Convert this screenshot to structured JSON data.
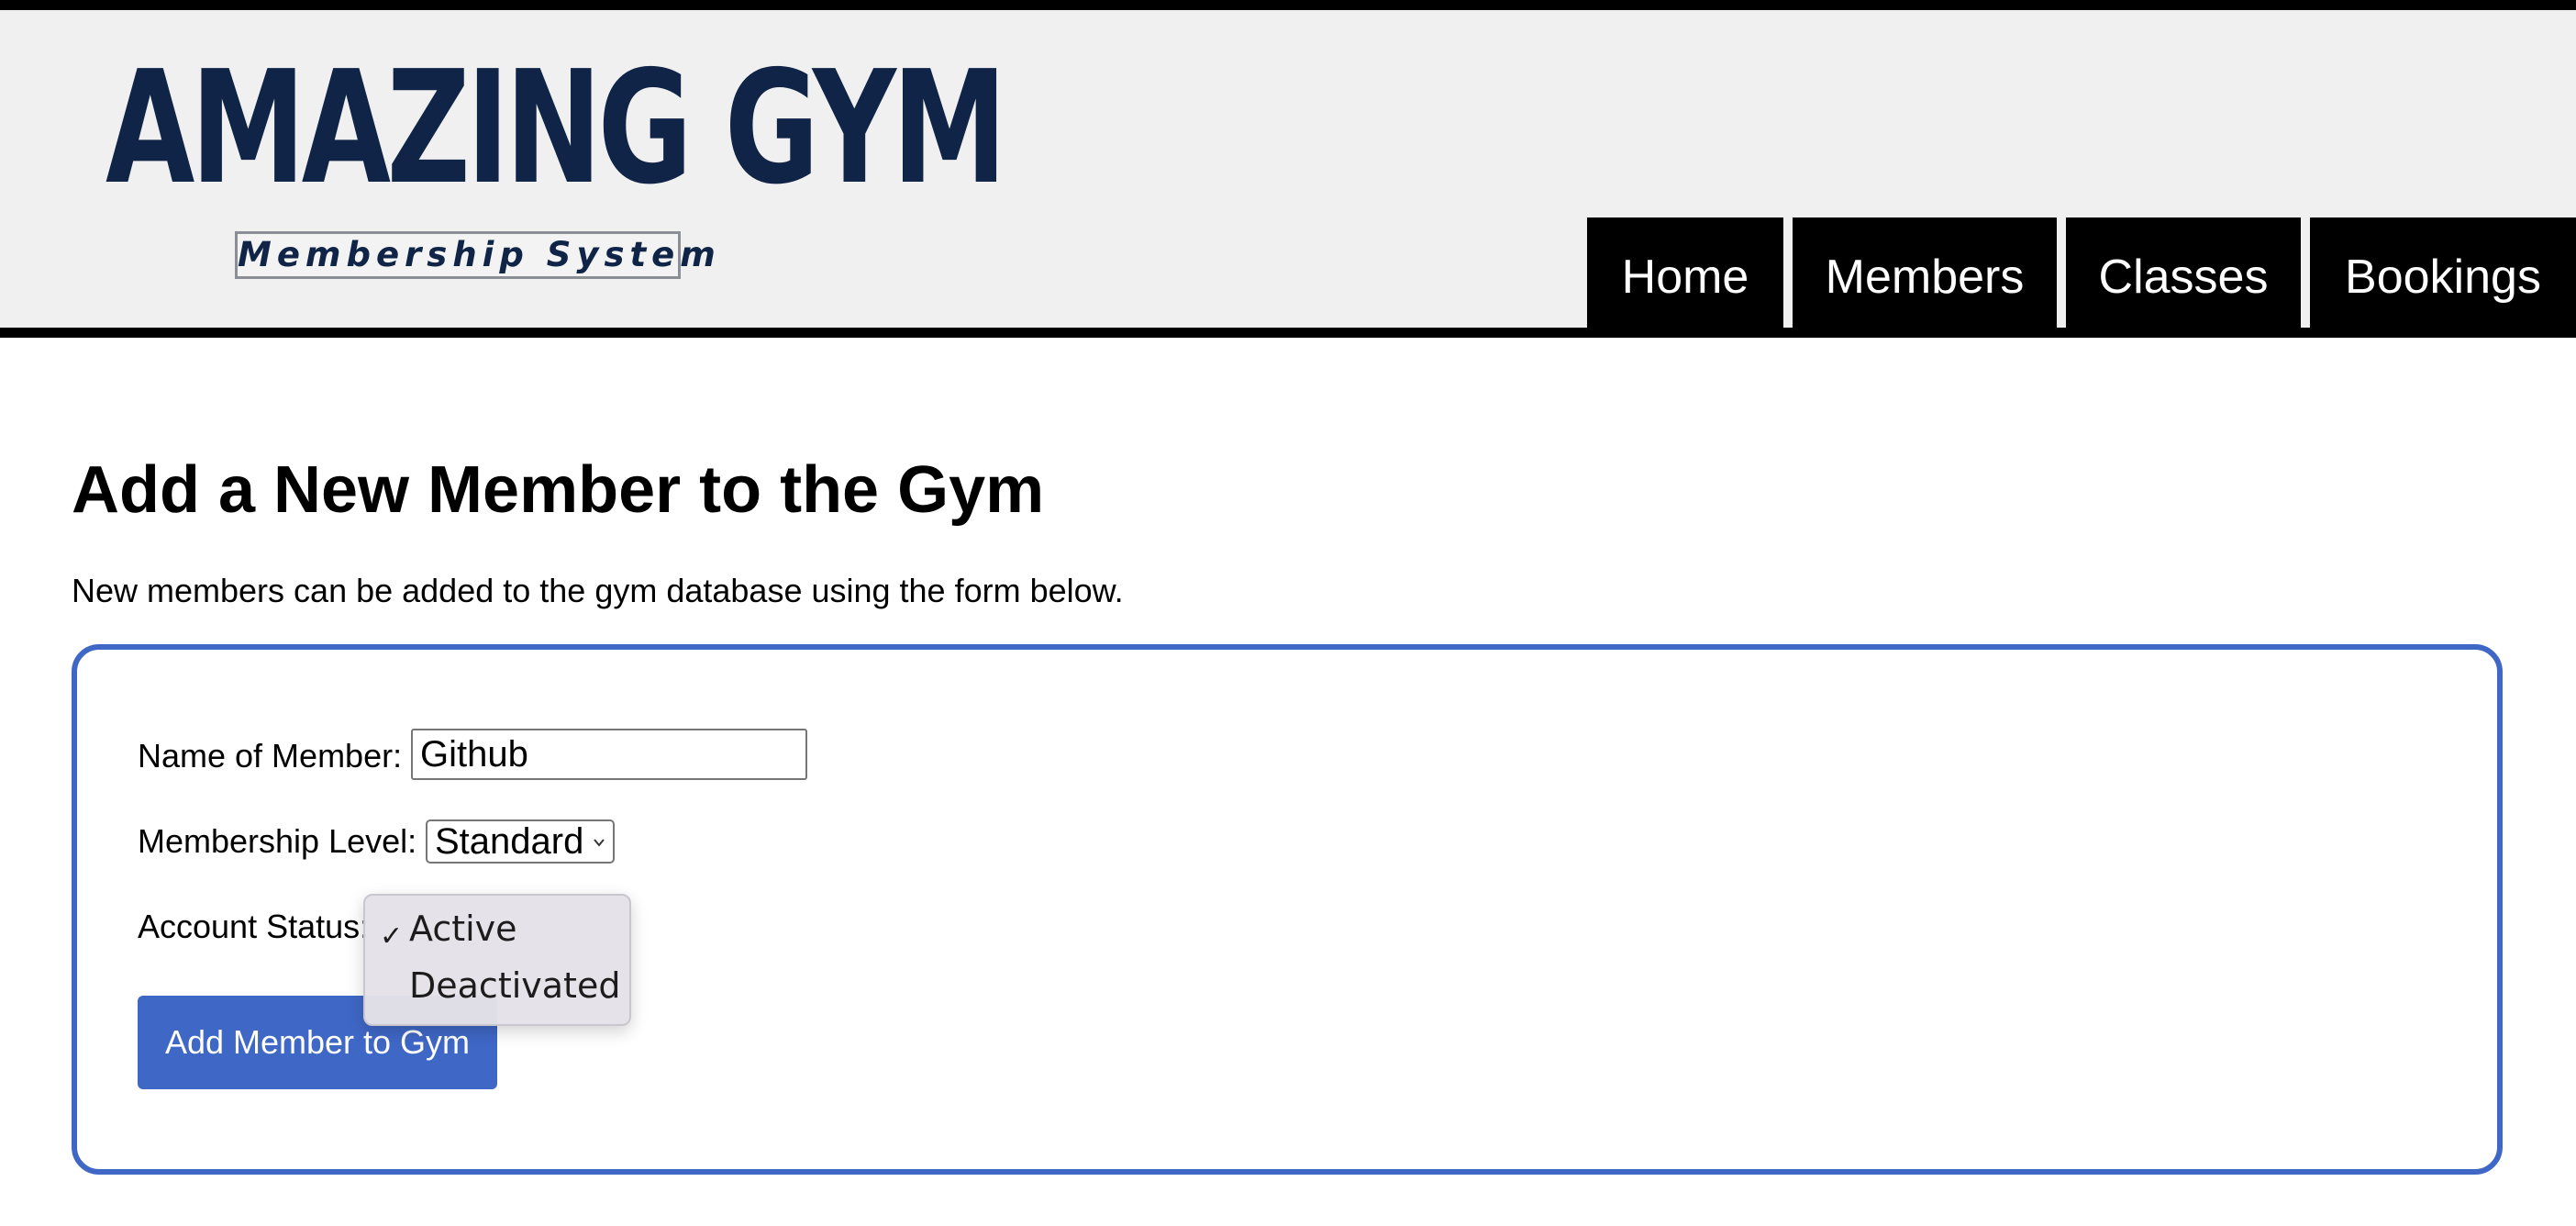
{
  "header": {
    "logo_title": "AMAZING GYM",
    "logo_subtitle": "Membership System",
    "nav": [
      {
        "label": "Home"
      },
      {
        "label": "Members"
      },
      {
        "label": "Classes"
      },
      {
        "label": "Bookings"
      }
    ]
  },
  "main": {
    "title": "Add a New Member to the Gym",
    "intro": "New members can be added to the gym database using the form below.",
    "form": {
      "name_label": "Name of Member:",
      "name_value": "Github",
      "level_label": "Membership Level:",
      "level_value": "Standard",
      "status_label": "Account Status:",
      "status_options": [
        {
          "label": "Active",
          "selected": true
        },
        {
          "label": "Deactivated",
          "selected": false
        }
      ],
      "submit_label": "Add Member to Gym"
    }
  },
  "colors": {
    "accent": "#3f67c6",
    "logo": "#0f2447",
    "header_bg": "#f0f0f0",
    "nav_bg": "#000000"
  },
  "icons": {
    "select_chevron": "chevron-down-icon",
    "selected_option": "check-icon"
  }
}
